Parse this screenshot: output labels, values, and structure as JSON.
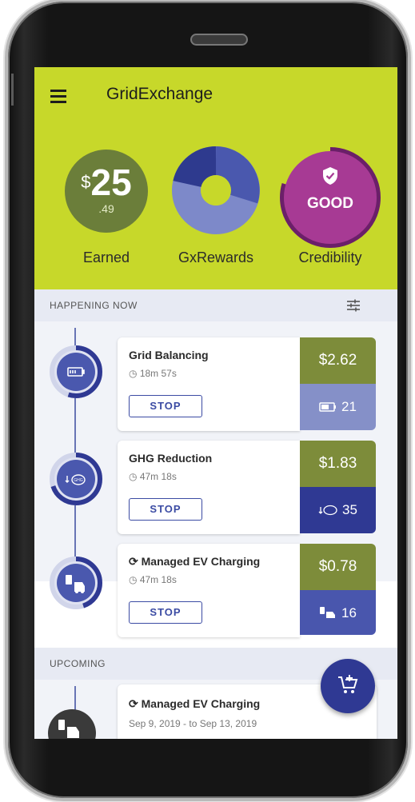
{
  "app": {
    "title": "GridExchange"
  },
  "colors": {
    "header": "#c7d82a",
    "earned": "#6b7e3a",
    "credibility": "#a73a94",
    "primary": "#2f3993",
    "money": "#7d8c3a"
  },
  "stats": {
    "earned": {
      "currency": "$",
      "whole": "25",
      "cents": ".49",
      "label": "Earned"
    },
    "rewards": {
      "label": "GxRewards"
    },
    "credibility": {
      "value": "GOOD",
      "label": "Credibility"
    }
  },
  "sections": {
    "happening_now": "HAPPENING NOW",
    "upcoming": "UPCOMING"
  },
  "activities": [
    {
      "title": "Grid Balancing",
      "time": "18m 57s",
      "action": "STOP",
      "amount": "$2.62",
      "metric": "21",
      "metric_icon": "battery-icon",
      "metric_color": "#8590c8",
      "progress": 0.55
    },
    {
      "title": "GHG Reduction",
      "time": "47m 18s",
      "action": "STOP",
      "amount": "$1.83",
      "metric": "35",
      "metric_icon": "ghg-icon",
      "metric_color": "#2f3993",
      "progress": 0.7
    },
    {
      "title": "Managed EV Charging",
      "time": "47m 18s",
      "action": "STOP",
      "amount": "$0.78",
      "metric": "16",
      "metric_icon": "ev-charger-icon",
      "metric_color": "#4956ad",
      "progress": 0.45
    }
  ],
  "upcoming": [
    {
      "title": "Managed EV Charging",
      "dates": "Sep 9, 2019 - to Sep 13, 2019"
    }
  ]
}
